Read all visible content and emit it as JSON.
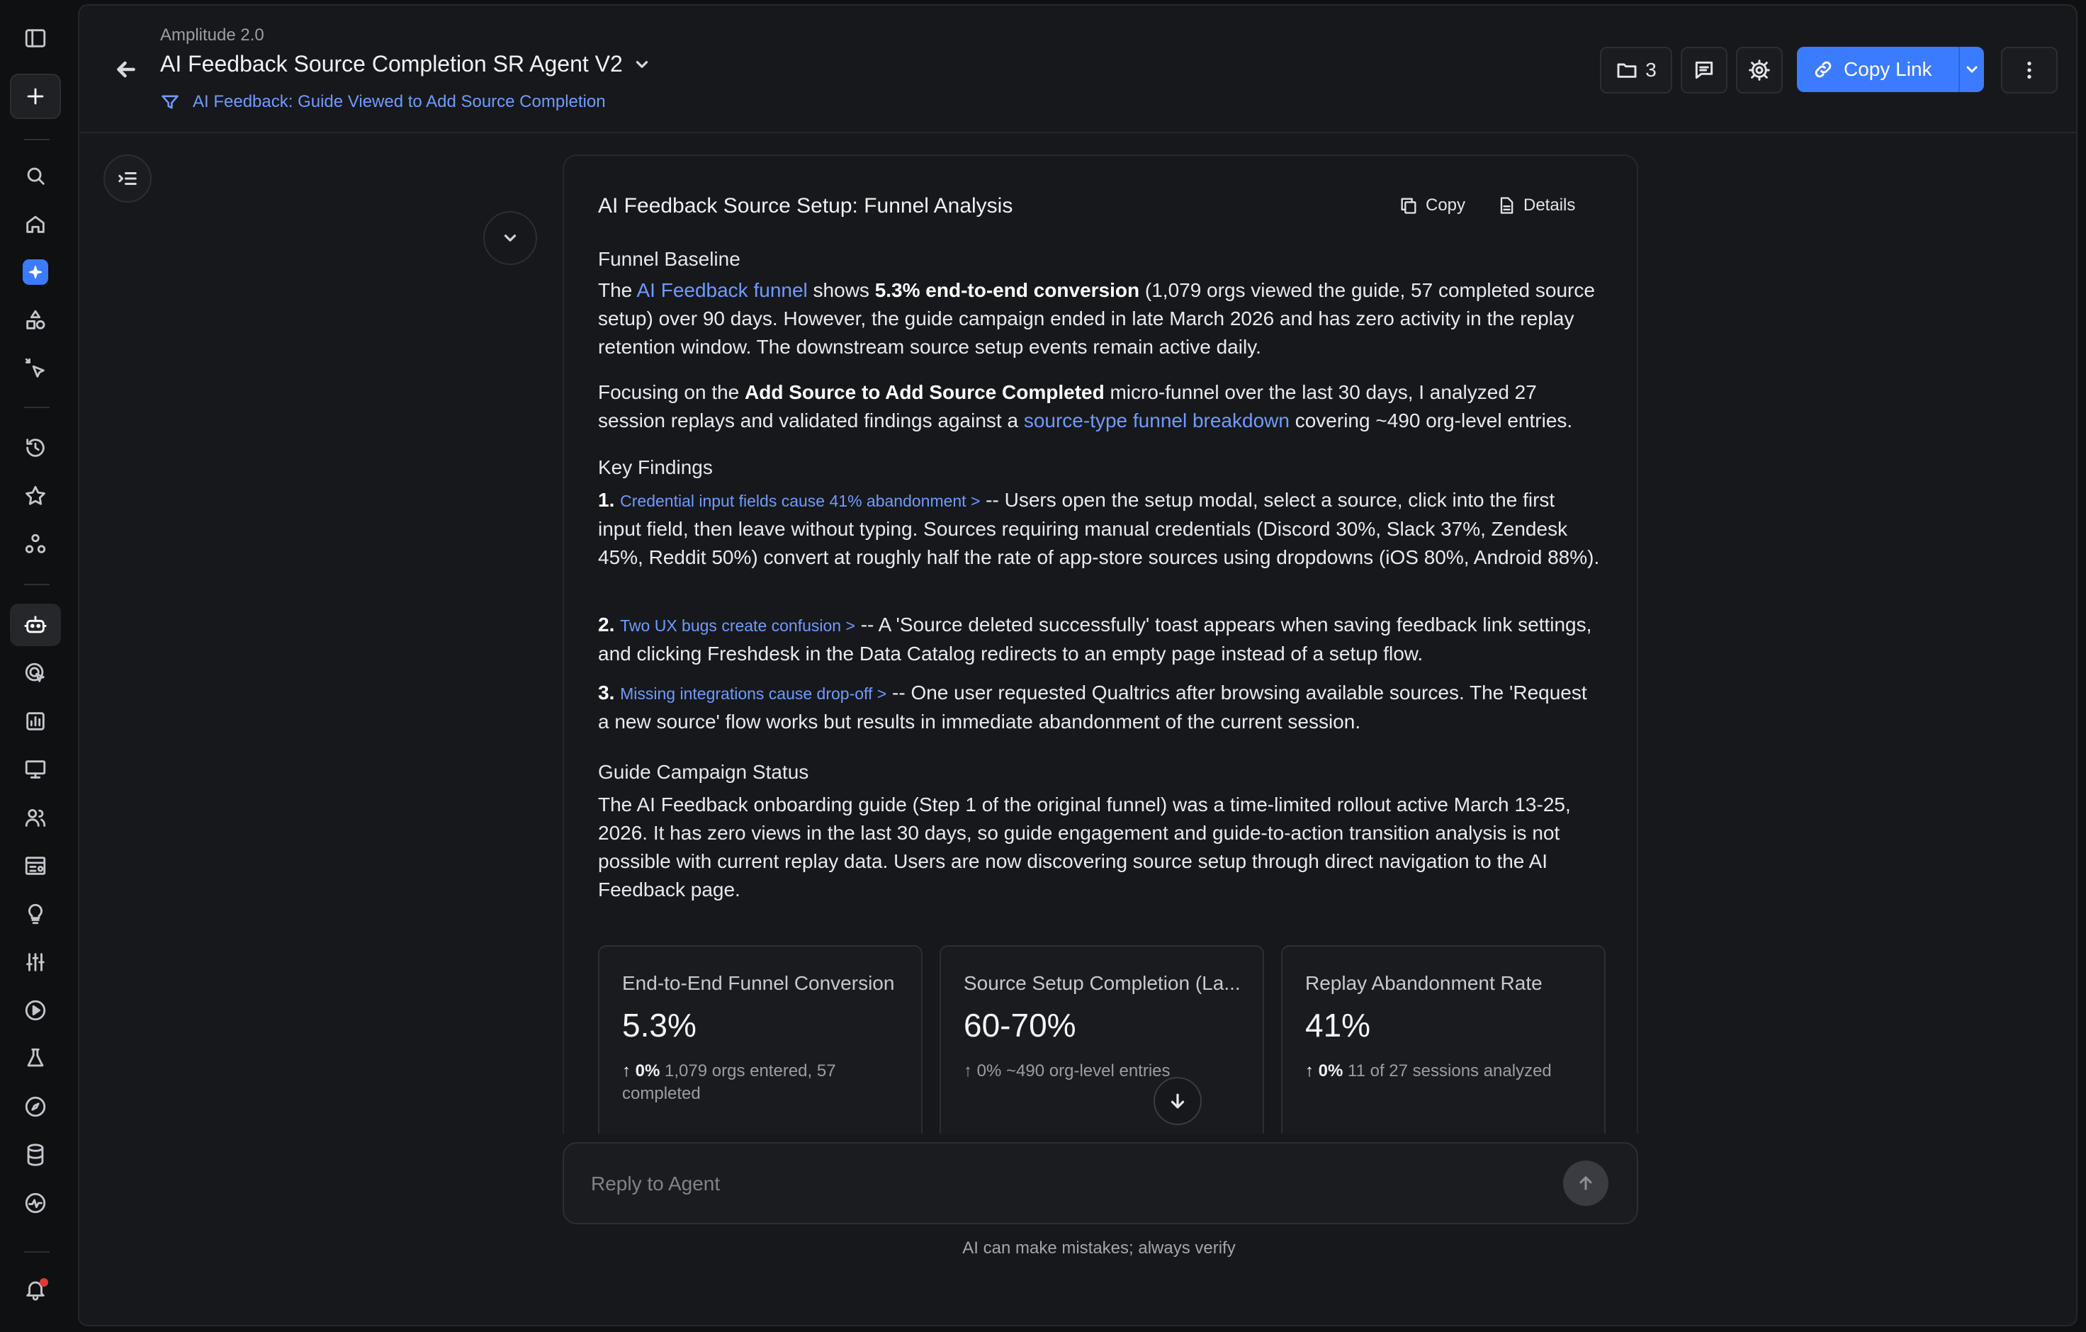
{
  "header": {
    "project": "Amplitude 2.0",
    "title": "AI Feedback Source Completion SR Agent V2",
    "subtitle": "AI Feedback: Guide Viewed to Add Source Completion",
    "folder_count": "3",
    "copy_link_label": "Copy Link"
  },
  "card": {
    "title": "AI Feedback Source Setup: Funnel Analysis",
    "copy_label": "Copy",
    "details_label": "Details",
    "funnel_baseline": {
      "heading": "Funnel Baseline",
      "p1_pre": "The ",
      "p1_link": "AI Feedback funnel",
      "p1_mid": " shows ",
      "p1_bold": "5.3% end-to-end conversion",
      "p1_post": " (1,079 orgs viewed the guide, 57 completed source setup) over 90 days. However, the guide campaign ended in late March 2026 and has zero activity in the replay retention window. The downstream source setup events remain active daily.",
      "p2_pre": "Focusing on the ",
      "p2_bold": "Add Source to Add Source Completed",
      "p2_mid": " micro-funnel over the last 30 days, I analyzed 27 session replays and validated findings against a ",
      "p2_link": "source-type funnel breakdown",
      "p2_post": " covering ~490 org-level entries."
    },
    "key_findings": {
      "heading": "Key Findings",
      "items": [
        {
          "num": "1.",
          "link": "Credential input fields cause 41% abandonment >",
          "text": " -- Users open the setup modal, select a source, click into the first input field, then leave without typing. Sources requiring manual credentials (Discord 30%, Slack 37%, Zendesk 45%, Reddit 50%) convert at roughly half the rate of app-store sources using dropdowns (iOS 80%, Android 88%)."
        },
        {
          "num": "2.",
          "link": "Two UX bugs create confusion >",
          "text": " -- A 'Source deleted successfully' toast appears when saving feedback link settings, and clicking Freshdesk in the Data Catalog redirects to an empty page instead of a setup flow."
        },
        {
          "num": "3.",
          "link": "Missing integrations cause drop-off >",
          "text": " -- One user requested Qualtrics after browsing available sources. The 'Request a new source' flow works but results in immediate abandonment of the current session."
        }
      ]
    },
    "guide_status": {
      "heading": "Guide Campaign Status",
      "text": "The AI Feedback onboarding guide (Step 1 of the original funnel) was a time-limited rollout active March 13-25, 2026. It has zero views in the last 30 days, so guide engagement and guide-to-action transition analysis is not possible with current replay data. Users are now discovering source setup through direct navigation to the AI Feedback page."
    },
    "metrics": [
      {
        "label": "End-to-End Funnel Conversion",
        "value": "5.3%",
        "delta": "↑ 0%",
        "note": "1,079 orgs entered, 57 completed"
      },
      {
        "label": "Source Setup Completion (La...",
        "value": "60-70%",
        "delta": "↑ 0%",
        "note": "~490 org-level entries"
      },
      {
        "label": "Replay Abandonment Rate",
        "value": "41%",
        "delta": "↑ 0%",
        "note": "11 of 27 sessions analyzed"
      }
    ]
  },
  "reply": {
    "placeholder": "Reply to Agent",
    "disclaimer": "AI can make mistakes; always verify"
  },
  "colors": {
    "accent": "#3b7bff",
    "link": "#6f9bff",
    "background": "#17181b",
    "notification": "#e53935"
  }
}
